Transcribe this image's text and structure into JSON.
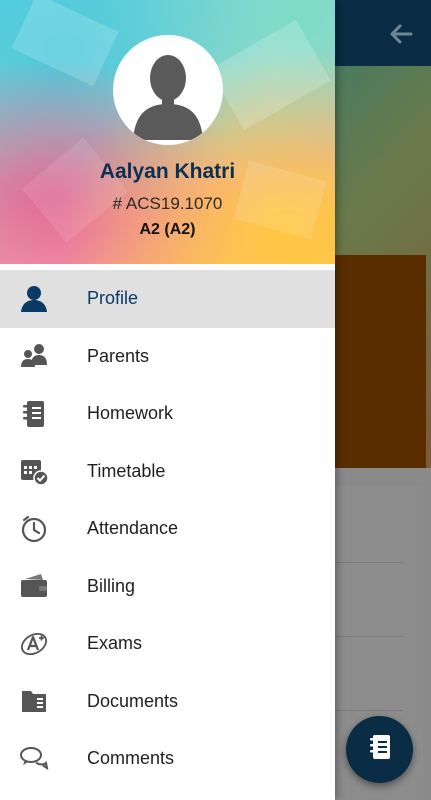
{
  "colors": {
    "primary": "#0a2c44",
    "active_text": "#0c3a66",
    "name_text": "#0c2f54",
    "active_bg": "#e0e0e0",
    "icon_grey": "#555555"
  },
  "toolbar": {
    "back_icon": "arrow-left-icon"
  },
  "fab": {
    "icon": "notebook-icon"
  },
  "profile": {
    "name": "Aalyan Khatri",
    "id": "# ACS19.1070",
    "class": "A2 (A2)",
    "avatar_icon": "user-silhouette-icon"
  },
  "menu": {
    "items": [
      {
        "label": "Profile",
        "icon": "person-icon",
        "active": true
      },
      {
        "label": "Parents",
        "icon": "parents-icon",
        "active": false
      },
      {
        "label": "Homework",
        "icon": "notebook-icon",
        "active": false
      },
      {
        "label": "Timetable",
        "icon": "calendar-check-icon",
        "active": false
      },
      {
        "label": "Attendance",
        "icon": "clock-icon",
        "active": false
      },
      {
        "label": "Billing",
        "icon": "wallet-icon",
        "active": false
      },
      {
        "label": "Exams",
        "icon": "exam-grade-icon",
        "active": false
      },
      {
        "label": "Documents",
        "icon": "folder-icon",
        "active": false
      },
      {
        "label": "Comments",
        "icon": "chat-bubbles-icon",
        "active": false
      }
    ]
  }
}
